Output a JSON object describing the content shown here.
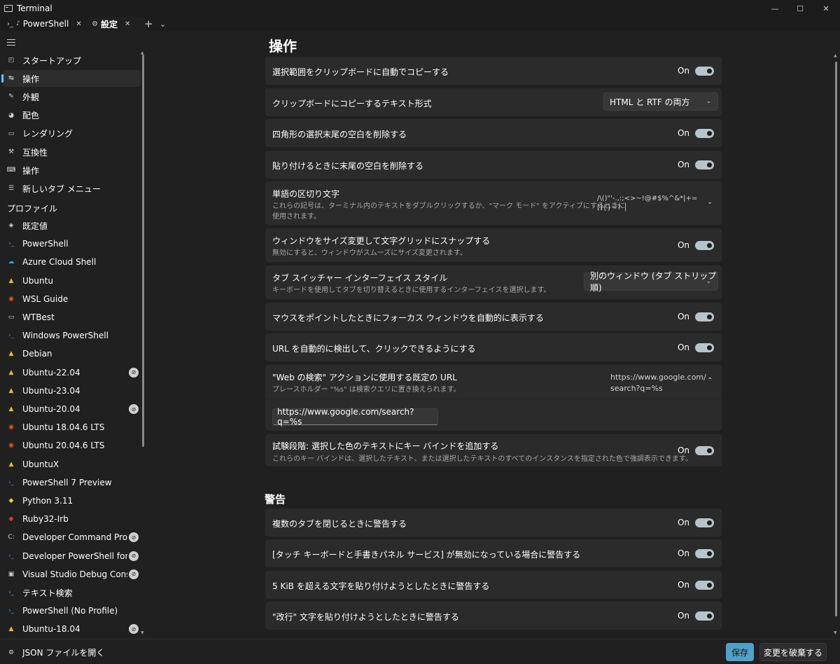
{
  "window": {
    "title": "Terminal",
    "minimize": "—",
    "maximize": "☐",
    "close": "✕"
  },
  "tabs": [
    {
      "label": "PowerShell",
      "icon": "powershell-icon"
    },
    {
      "label": "設定",
      "icon": "gear-icon"
    }
  ],
  "tab_controls": {
    "add": "+",
    "dropdown": "⌄"
  },
  "sidebar": {
    "settings_items": [
      {
        "label": "スタートアップ",
        "icon": "startup-icon",
        "glyph": "◰"
      },
      {
        "label": "操作",
        "icon": "interaction-icon",
        "glyph": "↹"
      },
      {
        "label": "外観",
        "icon": "brush-icon",
        "glyph": "✎"
      },
      {
        "label": "配色",
        "icon": "palette-icon",
        "glyph": "◕"
      },
      {
        "label": "レンダリング",
        "icon": "monitor-icon",
        "glyph": "▭"
      },
      {
        "label": "互換性",
        "icon": "compat-icon",
        "glyph": "⚒"
      },
      {
        "label": "操作",
        "icon": "keyboard-icon",
        "glyph": "⌨"
      },
      {
        "label": "新しいタブ メニュー",
        "icon": "list-icon",
        "glyph": "☰"
      }
    ],
    "profiles_header": "プロファイル",
    "profiles": [
      {
        "label": "既定値",
        "icon": "layers-icon",
        "glyph": "◈",
        "color": "#d6d6d6",
        "hidden": false
      },
      {
        "label": "PowerShell",
        "icon": "powershell-icon",
        "glyph": "›_",
        "color": "#4a9be0",
        "hidden": false
      },
      {
        "label": "Azure Cloud Shell",
        "icon": "azure-icon",
        "glyph": "☁",
        "color": "#3ba0e6",
        "hidden": false
      },
      {
        "label": "Ubuntu",
        "icon": "linux-icon",
        "glyph": "▲",
        "color": "#e8b64a",
        "hidden": false
      },
      {
        "label": "WSL Guide",
        "icon": "ubuntu-icon",
        "glyph": "◉",
        "color": "#e95420",
        "hidden": false
      },
      {
        "label": "WTBest",
        "icon": "terminal-icon",
        "glyph": "▭",
        "color": "#cfcfcf",
        "hidden": false
      },
      {
        "label": "Windows PowerShell",
        "icon": "powershell-icon",
        "glyph": "›_",
        "color": "#3b7dd8",
        "hidden": false
      },
      {
        "label": "Debian",
        "icon": "linux-icon",
        "glyph": "▲",
        "color": "#e8b64a",
        "hidden": false
      },
      {
        "label": "Ubuntu-22.04",
        "icon": "linux-icon",
        "glyph": "▲",
        "color": "#e8b64a",
        "hidden": true
      },
      {
        "label": "Ubuntu-23.04",
        "icon": "linux-icon",
        "glyph": "▲",
        "color": "#e8b64a",
        "hidden": false
      },
      {
        "label": "Ubuntu-20.04",
        "icon": "linux-icon",
        "glyph": "▲",
        "color": "#e8b64a",
        "hidden": true
      },
      {
        "label": "Ubuntu 18.04.6 LTS",
        "icon": "ubuntu-icon",
        "glyph": "◉",
        "color": "#e95420",
        "hidden": false
      },
      {
        "label": "Ubuntu 20.04.6 LTS",
        "icon": "ubuntu-icon",
        "glyph": "◉",
        "color": "#e95420",
        "hidden": false
      },
      {
        "label": "UbuntuX",
        "icon": "linux-icon",
        "glyph": "▲",
        "color": "#e8b64a",
        "hidden": false
      },
      {
        "label": "PowerShell 7 Preview",
        "icon": "powershell-preview-icon",
        "glyph": "›_",
        "color": "#9b59d0",
        "hidden": false
      },
      {
        "label": "Python 3.11",
        "icon": "python-icon",
        "glyph": "◆",
        "color": "#f5c842",
        "hidden": false
      },
      {
        "label": "Ruby32-Irb",
        "icon": "ruby-icon",
        "glyph": "◆",
        "color": "#d93a3a",
        "hidden": false
      },
      {
        "label": "Developer Command Prompt",
        "icon": "dev-cmd-icon",
        "glyph": "C:",
        "color": "#cfcfcf",
        "hidden": true
      },
      {
        "label": "Developer PowerShell for VS",
        "icon": "dev-powershell-icon",
        "glyph": "›_",
        "color": "#3b7dd8",
        "hidden": true
      },
      {
        "label": "Visual Studio Debug Console",
        "icon": "debug-console-icon",
        "glyph": "▣",
        "color": "#cfcfcf",
        "hidden": true
      },
      {
        "label": "テキスト検索",
        "icon": "powershell-icon",
        "glyph": "›_",
        "color": "#4a9be0",
        "hidden": false
      },
      {
        "label": "PowerShell (No Profile)",
        "icon": "powershell-icon",
        "glyph": "›_",
        "color": "#4a9be0",
        "hidden": false
      },
      {
        "label": "Ubuntu-18.04",
        "icon": "linux-icon",
        "glyph": "▲",
        "color": "#e8b64a",
        "hidden": true
      }
    ]
  },
  "footer": {
    "open_json": "JSON ファイルを開く",
    "save": "保存",
    "discard": "変更を破棄する"
  },
  "main": {
    "title": "操作",
    "settings": {
      "auto_copy": {
        "label": "選択範囲をクリップボードに自動でコピーする",
        "state": "On"
      },
      "copy_format": {
        "label": "クリップボードにコピーするテキスト形式",
        "value": "HTML と RTF の両方"
      },
      "trim_block": {
        "label": "四角形の選択末尾の空白を削除する",
        "state": "On"
      },
      "trim_paste": {
        "label": "貼り付けるときに末尾の空白を削除する",
        "state": "On"
      },
      "word_delim": {
        "label": "単語の区切り文字",
        "desc1": "これらの記号は、ターミナル内のテキストをダブルクリックするか、\"マーク モード\" をアクティブにするときに",
        "desc2": "使用されます。",
        "value": "/\\()\"'-.,:;<>~!@#$%^&*|+=[]{}~? │"
      },
      "snap_resize": {
        "label": "ウィンドウをサイズ変更して文字グリッドにスナップする",
        "desc": "無効にすると、ウィンドウがスムーズにサイズ変更されます。",
        "state": "On"
      },
      "tab_switcher": {
        "label": "タブ スイッチャー インターフェイス スタイル",
        "desc": "キーボードを使用してタブを切り替えるときに使用するインターフェイスを選択します。",
        "value": "別のウィンドウ (タブ ストリップ順)"
      },
      "focus_follow": {
        "label": "マウスをポイントしたときにフォーカス ウィンドウを自動的に表示する",
        "state": "On"
      },
      "detect_url": {
        "label": "URL を自動的に検出して、クリックできるようにする",
        "state": "On"
      },
      "search_url": {
        "label": "\"Web の検索\" アクションに使用する既定の URL",
        "desc": "プレースホルダー \"%s\" は検索クエリに置き換えられます。",
        "value_line1": "https://www.google.com/",
        "value_line2": "search?q=%s",
        "input": "https://www.google.com/search?q=%s"
      },
      "color_keybind": {
        "label": "試験段階: 選択した色のテキストにキー バインドを追加する",
        "desc": "これらのキー バインドは、選択したテキスト、または選択したテキストのすべてのインスタンスを指定された色で強調表示できます。",
        "state": "On"
      }
    },
    "warnings_title": "警告",
    "warnings": {
      "close_tabs": {
        "label": "複数のタブを閉じるときに警告する",
        "state": "On"
      },
      "touch_keyboard": {
        "label": "[タッチ キーボードと手書きパネル サービス] が無効になっている場合に警告する",
        "state": "On"
      },
      "large_paste": {
        "label": "5 KiB を超える文字を貼り付けようとしたときに警告する",
        "state": "On"
      },
      "newline_paste": {
        "label": "\"改行\" 文字を貼り付けようとしたときに警告する",
        "state": "On"
      }
    }
  },
  "colors": {
    "accent": "#60cdff",
    "card": "#2b2b2b",
    "background": "#202020"
  }
}
